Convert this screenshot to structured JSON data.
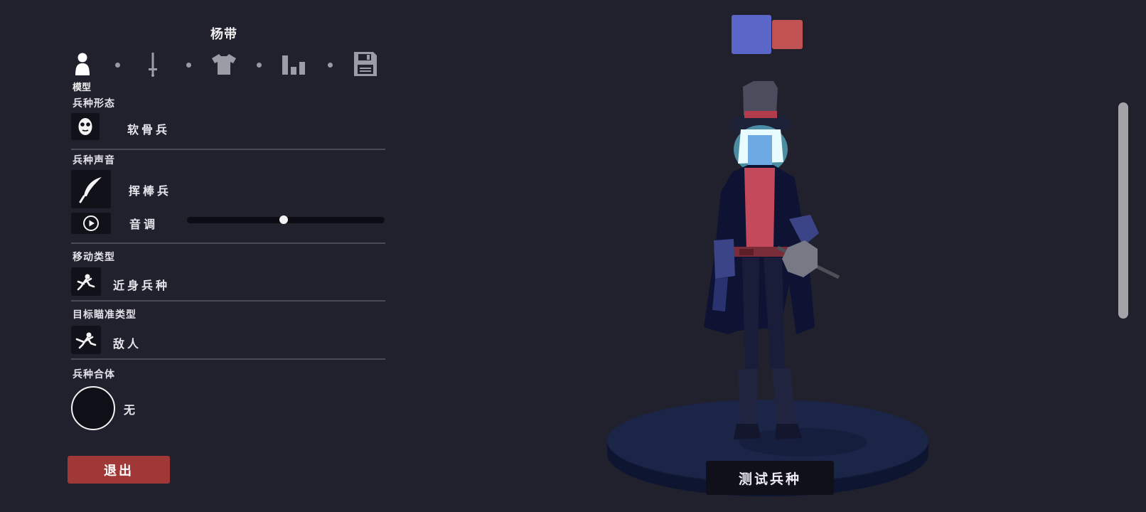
{
  "header": {
    "unit_name": "杨带"
  },
  "tabs": [
    {
      "icon": "person-icon",
      "label": "模型",
      "active": true
    },
    {
      "icon": "sword-icon",
      "active": false
    },
    {
      "icon": "shirt-icon",
      "active": false
    },
    {
      "icon": "stats-bars-icon",
      "active": false
    },
    {
      "icon": "save-icon",
      "active": false
    }
  ],
  "sections": {
    "form": {
      "label": "兵种形态",
      "value": "软骨兵",
      "icon": "ragdoll-face-icon"
    },
    "voice": {
      "label": "兵种声音",
      "value": "挥棒兵",
      "icon": "feather-icon",
      "pitch_label": "音调",
      "pitch_value": 0.49
    },
    "movement": {
      "label": "移动类型",
      "value": "近身兵种",
      "icon": "melee-unit-icon"
    },
    "targeting": {
      "label": "目标瞄准类型",
      "value": "敌人",
      "icon": "target-enemy-icon"
    },
    "merge": {
      "label": "兵种合体",
      "value": "无"
    }
  },
  "buttons": {
    "exit": "退出",
    "test_unit": "测试兵种"
  },
  "team_colors": {
    "blue": "#5a67c9",
    "red": "#c25353"
  },
  "colors": {
    "background": "#21212d",
    "exit_button": "#a03838",
    "panel_box": "#111119"
  }
}
